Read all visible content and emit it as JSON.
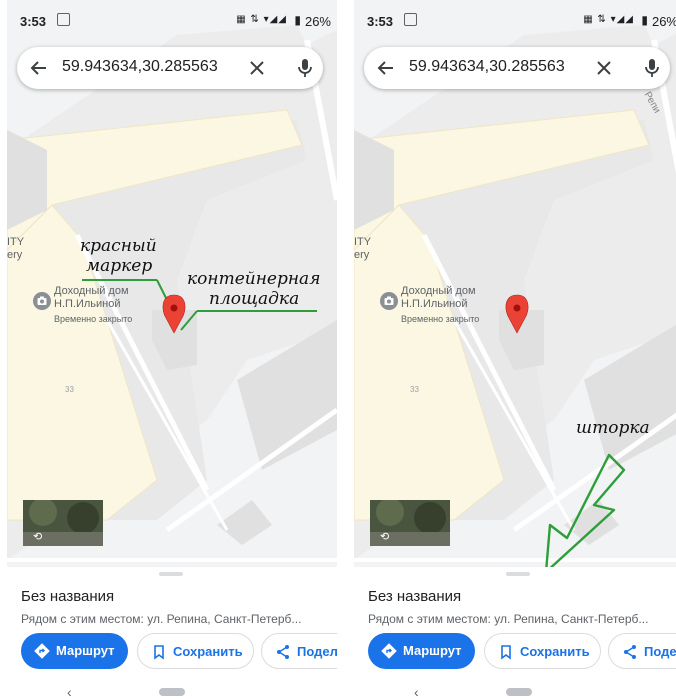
{
  "statusbar": {
    "time": "3:53",
    "icons": "▦ ⇅ ▾◢◢",
    "battery": "26%"
  },
  "search": {
    "query": "59.943634,30.285563"
  },
  "map": {
    "poi_name_line1": "Доходный дом",
    "poi_name_line2": "Н.П.Ильиной",
    "poi_status": "Временно закрыто",
    "building_number": "33",
    "edge_label_line1": "ITY",
    "edge_label_line2": "ery",
    "street_label": "Репи"
  },
  "sheet": {
    "title": "Без названия",
    "subtitle": "Рядом с этим местом: ул. Репина, Санкт-Петерб...",
    "route_label": "Маршрут",
    "save_label": "Сохранить",
    "share_label": "Подел"
  },
  "annotations": {
    "red_marker": "красный маркер",
    "red_marker_line1": "красный",
    "red_marker_line2": "маркер",
    "container_line1": "контейнерная",
    "container_line2": "площадка",
    "curtain": "шторка"
  },
  "colors": {
    "accent": "#1a73e8",
    "marker": "#ea4335",
    "annotation_line": "#2e9e3a",
    "building_fill": "#fbf7e3"
  }
}
